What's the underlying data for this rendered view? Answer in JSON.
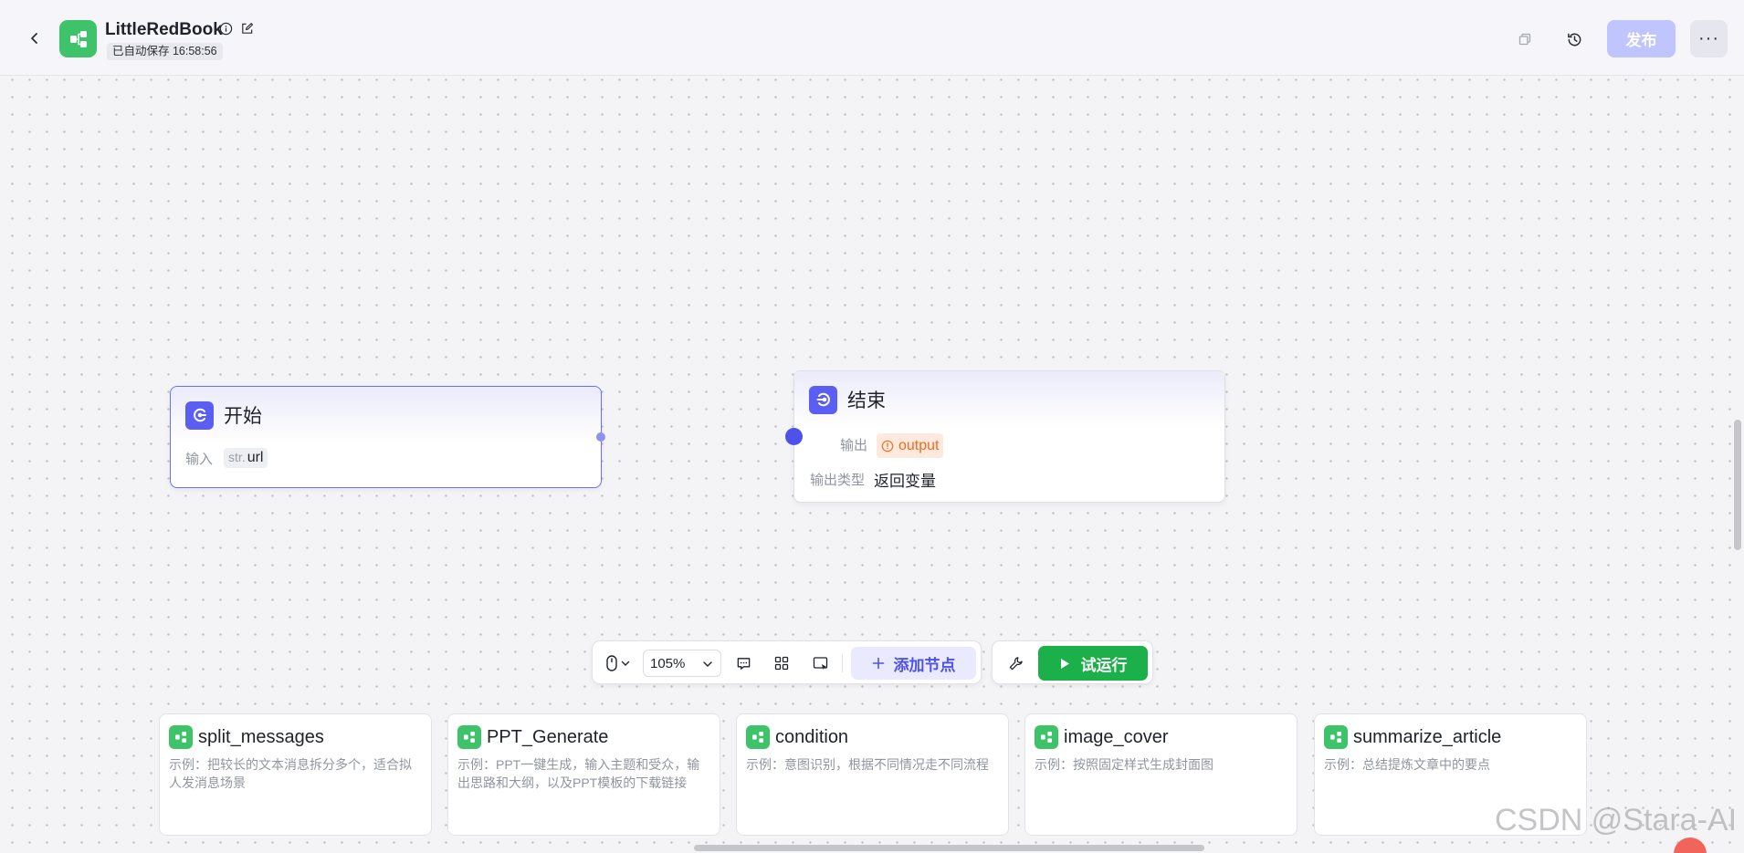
{
  "header": {
    "title": "LittleRedBook",
    "autosave": "已自动保存 16:58:56",
    "publish_label": "发布",
    "more_label": "···"
  },
  "nodes": {
    "start": {
      "title": "开始",
      "input_label": "输入",
      "param_type": "str.",
      "param_name": "url"
    },
    "end": {
      "title": "结束",
      "output_label": "输出",
      "output_var": "output",
      "output_type_label": "输出类型",
      "output_type_value": "返回变量"
    }
  },
  "toolbar": {
    "zoom": "105%",
    "add_node_label": "添加节点",
    "run_label": "试运行"
  },
  "templates": [
    {
      "name": "split_messages",
      "desc": "示例：把较长的文本消息拆分多个，适合拟人发消息场景"
    },
    {
      "name": "PPT_Generate",
      "desc": "示例：PPT一键生成，输入主题和受众，输出思路和大纲，以及PPT模板的下载链接"
    },
    {
      "name": "condition",
      "desc": "示例：意图识别，根据不同情况走不同流程"
    },
    {
      "name": "image_cover",
      "desc": "示例：按照固定样式生成封面图"
    },
    {
      "name": "summarize_article",
      "desc": "示例：总结提炼文章中的要点"
    }
  ],
  "watermark": "CSDN @Stara-AI",
  "colors": {
    "primary": "#5b5ef2",
    "run_green": "#1bb04a",
    "template_green": "#3ec26a",
    "warning_orange": "#ef6b1f",
    "publish_disabled": "#c0c4ff"
  }
}
